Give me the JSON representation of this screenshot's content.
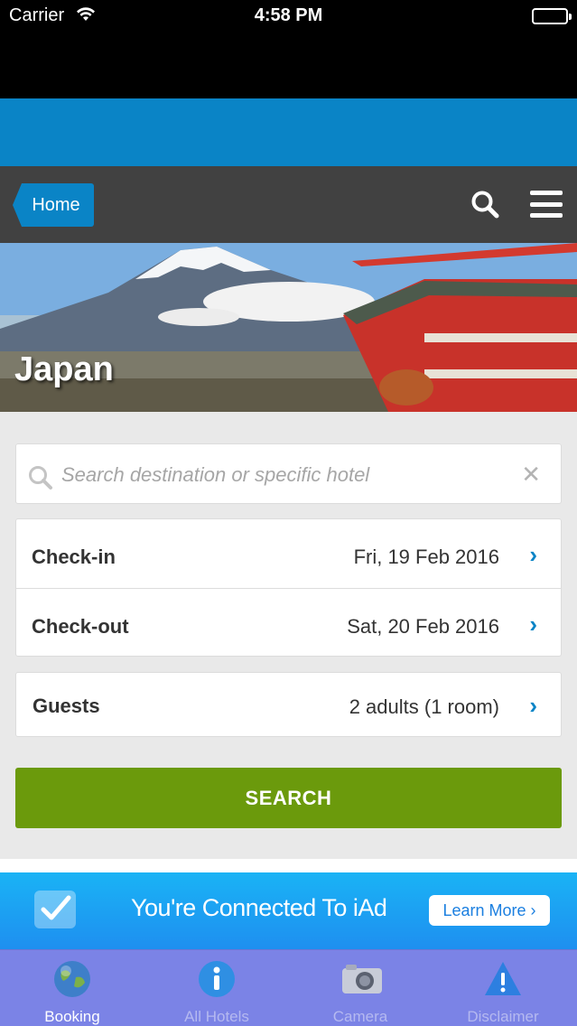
{
  "status_bar": {
    "carrier": "Carrier",
    "time": "4:58 PM"
  },
  "nav": {
    "home_label": "Home"
  },
  "hero": {
    "title": "Japan"
  },
  "search": {
    "placeholder": "Search destination or specific hotel",
    "clear_glyph": "✕"
  },
  "dates": {
    "checkin_label": "Check-in",
    "checkin_value": "Fri, 19 Feb 2016",
    "checkout_label": "Check-out",
    "checkout_value": "Sat, 20 Feb 2016"
  },
  "guests": {
    "label": "Guests",
    "value": "2 adults (1 room)"
  },
  "chevron_glyph": "›",
  "search_button": "SEARCH",
  "iad": {
    "message": "You're Connected To iAd",
    "learn_more": "Learn More ›"
  },
  "tabs": [
    {
      "label": "Booking",
      "icon": "globe-icon",
      "active": true
    },
    {
      "label": "All Hotels",
      "icon": "info-icon",
      "active": false
    },
    {
      "label": "Camera",
      "icon": "camera-icon",
      "active": false
    },
    {
      "label": "Disclaimer",
      "icon": "warning-icon",
      "active": false
    }
  ],
  "colors": {
    "brand_blue": "#0a84c6",
    "nav_dark": "#414141",
    "search_green": "#6b9a0c",
    "tab_bar": "#7b83e6"
  }
}
